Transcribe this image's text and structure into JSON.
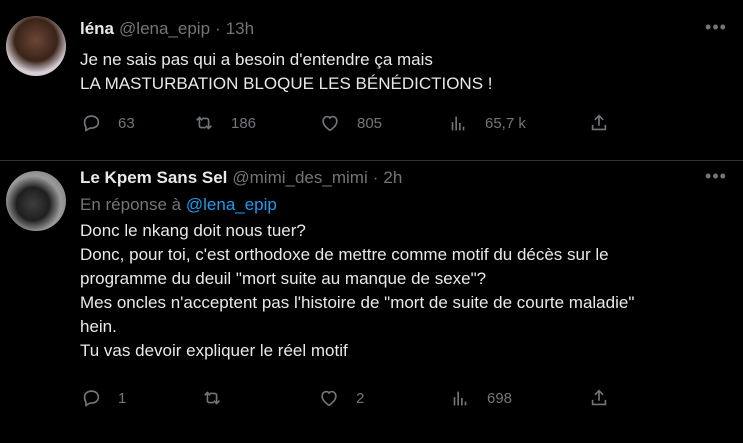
{
  "tweets": [
    {
      "name": "léna",
      "handle": "@lena_epip",
      "time": "13h",
      "lines": [
        "Je ne sais pas qui a besoin d'entendre ça mais",
        "LA MASTURBATION BLOQUE LES BÉNÉDICTIONS !"
      ],
      "stats": {
        "replies": "63",
        "retweets": "186",
        "likes": "805",
        "views": "65,7 k"
      }
    },
    {
      "name": "Le Kpem Sans Sel",
      "handle": "@mimi_des_mimi",
      "time": "2h",
      "reply_prefix": "En réponse à",
      "reply_handle": "@lena_epip",
      "lines": [
        "Donc le nkang doit nous tuer?",
        "Donc, pour toi, c'est orthodoxe de mettre comme motif du décès sur le",
        "programme du deuil \"mort suite au manque de sexe\"?",
        "Mes oncles n'acceptent pas l'histoire de \"mort de suite de courte maladie\"",
        "hein.",
        "Tu vas devoir expliquer le réel motif"
      ],
      "stats": {
        "replies": "1",
        "retweets": "",
        "likes": "2",
        "views": "698"
      }
    }
  ],
  "icons": {
    "reply": "reply-icon",
    "retweet": "retweet-icon",
    "like": "heart-icon",
    "views": "views-icon",
    "share": "share-icon",
    "more": "more-icon"
  },
  "dot": "·",
  "colors": {
    "background": "#000000",
    "text": "#e7e9ea",
    "muted": "#71767b",
    "link": "#1d9bf0",
    "divider": "#2f3336"
  }
}
